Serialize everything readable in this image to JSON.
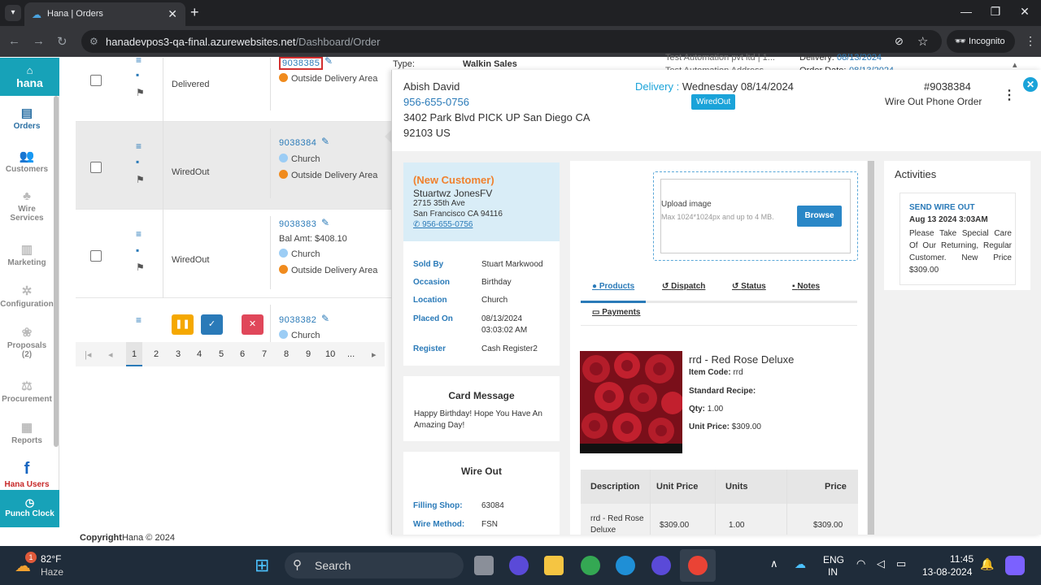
{
  "browser": {
    "tab_title": "Hana | Orders",
    "url_host": "hanadevpos3-qa-final.azurewebsites.net",
    "url_path": "/Dashboard/Order",
    "incognito_label": "Incognito"
  },
  "sidebar": {
    "logo": "hana",
    "items": [
      {
        "label": "Orders",
        "icon": "orders-icon"
      },
      {
        "label": "Customers",
        "icon": "customers-icon"
      },
      {
        "label": "Wire Services",
        "icon": "wire-services-icon"
      },
      {
        "label": "Marketing",
        "icon": "marketing-icon"
      },
      {
        "label": "Configuration",
        "icon": "configuration-icon"
      },
      {
        "label": "Proposals (2)",
        "icon": "proposals-icon"
      },
      {
        "label": "Procurement",
        "icon": "procurement-icon"
      },
      {
        "label": "Reports",
        "icon": "reports-icon"
      }
    ],
    "hana_users": "Hana Users",
    "punch_clock": "Punch Clock"
  },
  "orders": [
    {
      "status": "Delivered",
      "number": "9038385",
      "lines": [
        "Outside Delivery Area"
      ]
    },
    {
      "status": "WiredOut",
      "number": "9038384",
      "lines": [
        "Church",
        "Outside Delivery Area"
      ]
    },
    {
      "status": "WiredOut",
      "number": "9038383",
      "bal": "Bal Amt: $408.10",
      "lines": [
        "Church",
        "Outside Delivery Area"
      ]
    },
    {
      "number": "9038382",
      "lines": [
        "Church"
      ]
    }
  ],
  "pager": {
    "pages": [
      "1",
      "2",
      "3",
      "4",
      "5",
      "6",
      "7",
      "8",
      "9",
      "10",
      "..."
    ]
  },
  "copyright": {
    "brand": "Copyright",
    "text": "Hana © 2024"
  },
  "background_header": {
    "type_label": "Type:",
    "type_value": "Walkin Sales",
    "company": "Test Automation pvt ltd | 1...",
    "delivery_label": "Delivery:",
    "delivery_value": "08/13/2024",
    "company2": "Test Automation Address",
    "order_date_label": "Order Date:",
    "order_date_value": "08/13/2024"
  },
  "order_detail": {
    "recipient_name": "Abish David",
    "recipient_phone": "956-655-0756",
    "recipient_addr1": "3402 Park Blvd PICK UP San Diego CA",
    "recipient_addr2": "92103 US",
    "delivery_label": "Delivery :",
    "delivery_date": "Wednesday 08/14/2024",
    "status_badge": "WiredOut",
    "order_number": "#9038384",
    "order_type": "Wire Out Phone Order",
    "customer": {
      "tag": "(New Customer)",
      "name": "Stuartwz JonesFV",
      "addr1": "2715 35th Ave",
      "addr2": "San Francisco CA 94116",
      "phone": "956-655-0756"
    },
    "info": [
      {
        "label": "Sold By",
        "value": "Stuart Markwood"
      },
      {
        "label": "Occasion",
        "value": "Birthday"
      },
      {
        "label": "Location",
        "value": "Church"
      },
      {
        "label": "Placed On",
        "value": "08/13/2024"
      },
      {
        "label": "Register",
        "value": "Cash Register2"
      }
    ],
    "placed_time": "03:03:02 AM",
    "card_message_title": "Card Message",
    "card_message": "Happy Birthday! Hope You Have An Amazing Day!",
    "wire_out_title": "Wire Out",
    "filling_shop_label": "Filling Shop:",
    "filling_shop_value": "63084",
    "wire_method_label": "Wire Method:",
    "wire_method_value": "FSN"
  },
  "upload": {
    "title": "Upload image",
    "hint": "Max 1024*1024px and up to 4 MB.",
    "browse": "Browse"
  },
  "tabs": {
    "products": "Products",
    "dispatch": "Dispatch",
    "status": "Status",
    "notes": "Notes",
    "payments": "Payments"
  },
  "product": {
    "name": "rrd - Red Rose Deluxe",
    "item_code_label": "Item Code:",
    "item_code": "rrd",
    "recipe_label": "Standard Recipe:",
    "qty_label": "Qty:",
    "qty": "1.00",
    "unit_price_label": "Unit Price:",
    "unit_price": "$309.00"
  },
  "product_table": {
    "headers": [
      "Description",
      "Unit Price",
      "Units",
      "Price"
    ],
    "row": {
      "description": "rrd - Red Rose Deluxe",
      "unit_price": "$309.00",
      "units": "1.00",
      "price": "$309.00"
    }
  },
  "activities": {
    "title": "Activities",
    "event": "SEND WIRE OUT",
    "date": "Aug 13 2024 3:03AM",
    "note": "Please Take Special Care Of Our Returning, Regular Customer. New Price $309.00"
  },
  "taskbar": {
    "weather_temp": "82°F",
    "weather_desc": "Haze",
    "weather_badge": "1",
    "search": "Search",
    "lang1": "ENG",
    "lang2": "IN",
    "time": "11:45",
    "date": "13-08-2024"
  }
}
